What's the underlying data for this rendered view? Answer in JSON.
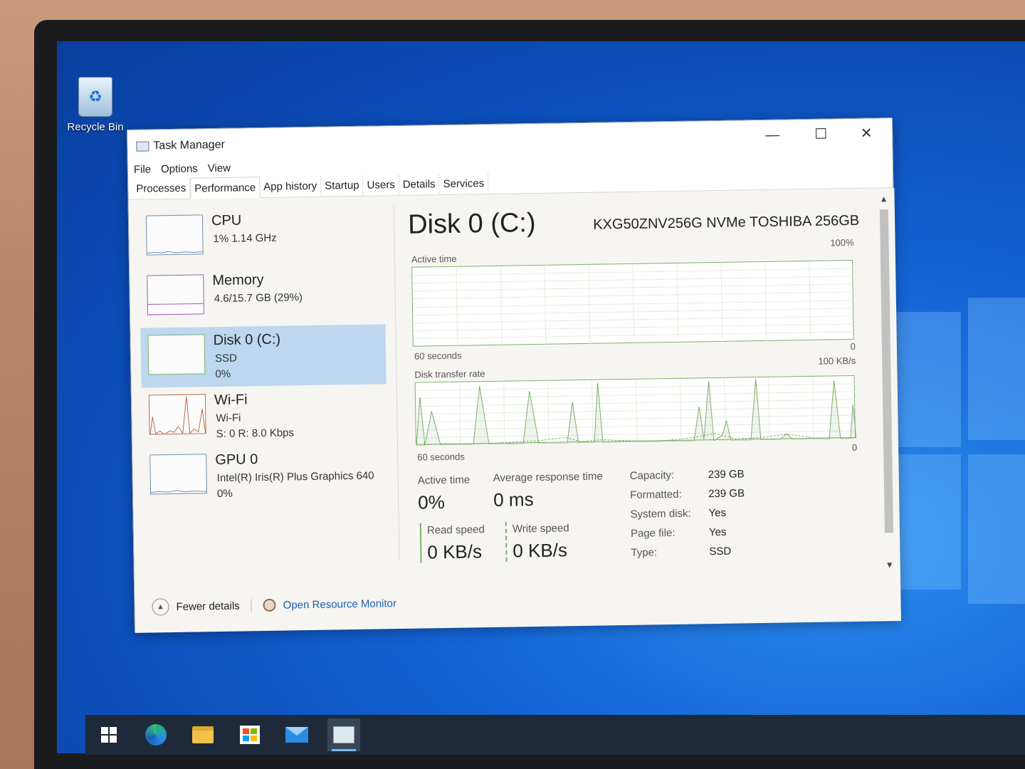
{
  "desktop": {
    "recycle_bin_label": "Recycle Bin"
  },
  "window": {
    "title": "Task Manager",
    "controls": {
      "minimize": "—",
      "maximize": "☐",
      "close": "✕"
    }
  },
  "menu": [
    "File",
    "Options",
    "View"
  ],
  "tabs": [
    "Processes",
    "Performance",
    "App history",
    "Startup",
    "Users",
    "Details",
    "Services"
  ],
  "active_tab": "Performance",
  "sidebar": {
    "items": [
      {
        "name": "CPU",
        "sub": "1%  1.14 GHz",
        "sub2": ""
      },
      {
        "name": "Memory",
        "sub": "4.6/15.7 GB (29%)",
        "sub2": ""
      },
      {
        "name": "Disk 0 (C:)",
        "sub": "SSD",
        "sub2": "0%"
      },
      {
        "name": "Wi-Fi",
        "sub": "Wi-Fi",
        "sub2": "S: 0  R: 8.0 Kbps"
      },
      {
        "name": "GPU 0",
        "sub": "Intel(R) Iris(R) Plus Graphics 640",
        "sub2": "0%"
      }
    ],
    "selected_index": 2
  },
  "main": {
    "title": "Disk 0 (C:)",
    "model": "KXG50ZNV256G NVMe TOSHIBA 256GB",
    "active_time_graph": {
      "label": "Active time",
      "max": "100%",
      "min": "0",
      "span": "60 seconds"
    },
    "transfer_graph": {
      "label": "Disk transfer rate",
      "max": "100 KB/s",
      "min": "0",
      "span": "60 seconds"
    },
    "stats": {
      "active_time_label": "Active time",
      "active_time_value": "0%",
      "avg_response_label": "Average response time",
      "avg_response_value": "0 ms",
      "read_label": "Read speed",
      "read_value": "0 KB/s",
      "write_label": "Write speed",
      "write_value": "0 KB/s"
    },
    "properties": [
      {
        "label": "Capacity:",
        "value": "239 GB"
      },
      {
        "label": "Formatted:",
        "value": "239 GB"
      },
      {
        "label": "System disk:",
        "value": "Yes"
      },
      {
        "label": "Page file:",
        "value": "Yes"
      },
      {
        "label": "Type:",
        "value": "SSD"
      }
    ]
  },
  "footer": {
    "fewer_details": "Fewer details",
    "resource_monitor": "Open Resource Monitor"
  },
  "taskbar": {
    "items": [
      "start-icon",
      "edge-icon",
      "file-explorer-icon",
      "store-icon",
      "mail-icon",
      "task-manager-icon"
    ]
  },
  "colors": {
    "disk_accent": "#7bb06a",
    "selection": "#bcd7ef",
    "link": "#1a5fb4"
  }
}
